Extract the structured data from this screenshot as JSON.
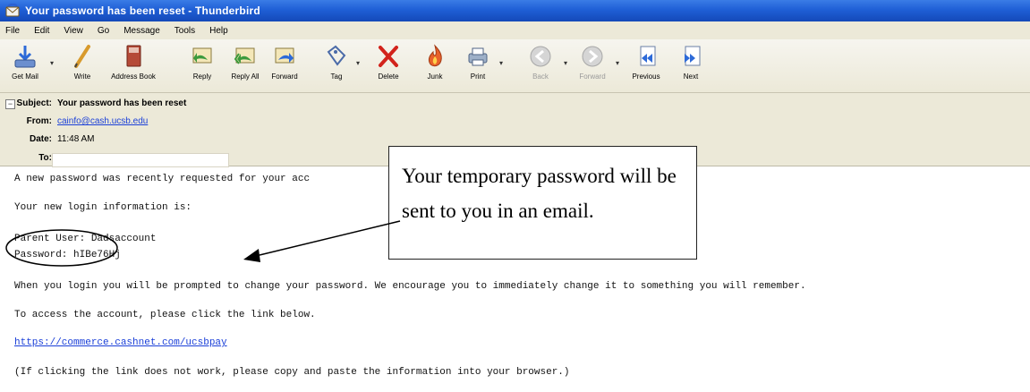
{
  "window": {
    "title": "Your password has been reset - Thunderbird"
  },
  "menu": [
    "File",
    "Edit",
    "View",
    "Go",
    "Message",
    "Tools",
    "Help"
  ],
  "toolbar": {
    "get_mail": "Get Mail",
    "write": "Write",
    "address_book": "Address Book",
    "reply": "Reply",
    "reply_all": "Reply All",
    "forward": "Forward",
    "tag": "Tag",
    "delete": "Delete",
    "junk": "Junk",
    "print": "Print",
    "back": "Back",
    "forward_nav": "Forward",
    "previous": "Previous",
    "next": "Next"
  },
  "header": {
    "subject_label": "Subject:",
    "subject": "Your password has been reset",
    "from_label": "From:",
    "from": "cainfo@cash.ucsb.edu",
    "date_label": "Date:",
    "date": "11:48 AM",
    "to_label": "To:"
  },
  "body": {
    "line1": "A new password was recently requested for your acc",
    "line2": "Your new login information is:",
    "line3": "Parent User: Dadsaccount",
    "line4": "Password: hIBe76Hj",
    "line5": "When you login you will be prompted to change your password. We encourage you to immediately change it to something you will remember.",
    "line6": "To access the account, please click the link below.",
    "link": "https://commerce.cashnet.com/ucsbpay",
    "line7": "(If clicking the link does not work, please copy and paste the information into your browser.)"
  },
  "callout": {
    "line1": "Your temporary password will be",
    "line2": "sent to you in an email."
  },
  "colors": {
    "title_bar": "#1f5fd6",
    "chrome": "#ece9d8",
    "link": "#1a3fd8"
  }
}
